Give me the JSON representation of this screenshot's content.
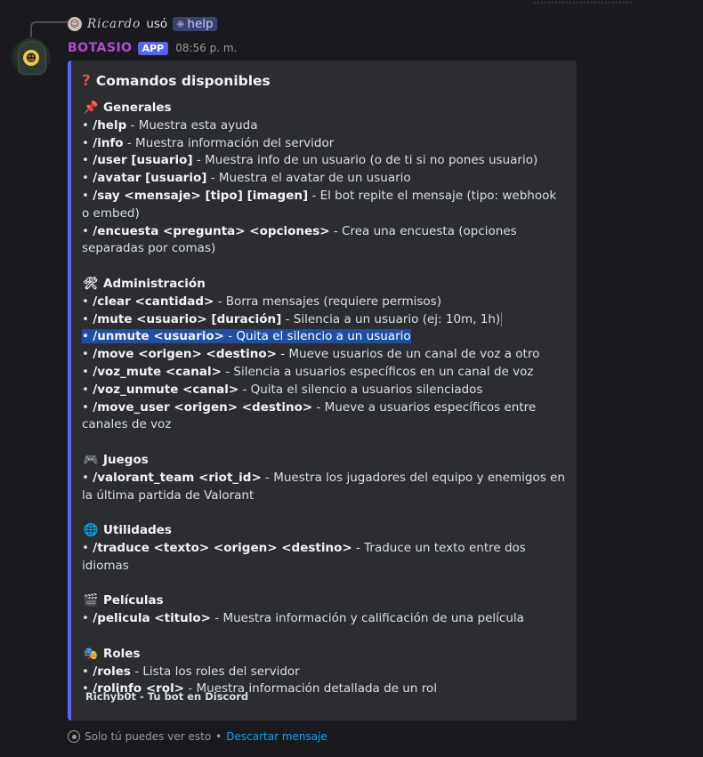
{
  "reply": {
    "username": "Ricardo",
    "action": "usó",
    "command": "help"
  },
  "message": {
    "bot_name": "BOTASIO",
    "app_badge": "APP",
    "time": "08:56 p. m."
  },
  "embed": {
    "title": "Comandos disponibles",
    "accent_color": "#5865f2",
    "sections": [
      {
        "icon": "📌",
        "icon_name": "pushpin-icon",
        "title": "Generales",
        "items": [
          {
            "cmd": "/help",
            "desc": " - Muestra esta ayuda"
          },
          {
            "cmd": "/info",
            "desc": " - Muestra información del servidor"
          },
          {
            "cmd": "/user [usuario]",
            "desc": " - Muestra info de un usuario (o de ti si no pones usuario)"
          },
          {
            "cmd": "/avatar [usuario]",
            "desc": " - Muestra el avatar de un usuario"
          },
          {
            "cmd": "/say <mensaje> [tipo] [imagen]",
            "desc": " - El bot repite el mensaje (tipo: webhook o embed)"
          },
          {
            "cmd": "/encuesta <pregunta> <opciones>",
            "desc": " - Crea una encuesta (opciones separadas por comas)"
          }
        ]
      },
      {
        "icon": "🛠",
        "icon_name": "tools-icon",
        "title": "Administración",
        "items": [
          {
            "cmd": "/clear <cantidad>",
            "desc": " - Borra mensajes (requiere permisos)"
          },
          {
            "cmd": "/mute <usuario> [duración]",
            "desc": " - Silencia a un usuario (ej: 10m, 1h)"
          },
          {
            "cmd": "/unmute <usuario>",
            "desc": " - Quita el silencio a un usuario",
            "selected": true
          },
          {
            "cmd": "/move <origen> <destino>",
            "desc": " - Mueve usuarios de un canal de voz a otro"
          },
          {
            "cmd": "/voz_mute <canal>",
            "desc": " - Silencia a usuarios específicos en un canal de voz"
          },
          {
            "cmd": "/voz_unmute <canal>",
            "desc": " - Quita el silencio a usuarios silenciados"
          },
          {
            "cmd": "/move_user <origen> <destino>",
            "desc": " - Mueve a usuarios específicos entre canales de voz"
          }
        ]
      },
      {
        "icon": "🎮",
        "icon_name": "game-controller-icon",
        "title": "Juegos",
        "items": [
          {
            "cmd": "/valorant_team <riot_id>",
            "desc": " - Muestra los jugadores del equipo y enemigos en la última partida de Valorant"
          }
        ]
      },
      {
        "icon": "🌐",
        "icon_name": "globe-icon",
        "title": "Utilidades",
        "items": [
          {
            "cmd": "/traduce <texto> <origen> <destino>",
            "desc": " - Traduce un texto entre dos idiomas"
          }
        ]
      },
      {
        "icon": "🎬",
        "icon_name": "clapper-board-icon",
        "title": "Películas",
        "items": [
          {
            "cmd": "/pelicula <titulo>",
            "desc": " - Muestra información y calificación de una película"
          }
        ]
      },
      {
        "icon": "🎭",
        "icon_name": "theater-masks-icon",
        "title": "Roles",
        "items": [
          {
            "cmd": "/roles",
            "desc": " - Lista los roles del servidor"
          },
          {
            "cmd": "/rolinfo <rol>",
            "desc": " - Muestra información detallada de un rol"
          }
        ]
      }
    ],
    "footer": "Richyb0t - Tu bot en Discord"
  },
  "ephemeral": {
    "text": "Solo tú puedes ver esto",
    "separator": " • ",
    "dismiss": "Descartar mensaje"
  }
}
